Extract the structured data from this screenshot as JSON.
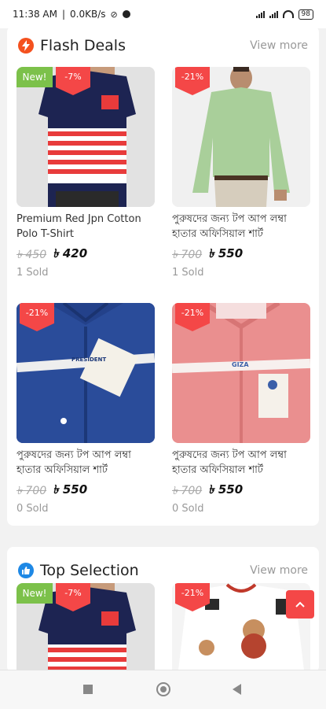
{
  "status_bar": {
    "time": "11:38 AM",
    "network_speed": "0.0KB/s",
    "battery": "98",
    "icons": [
      "sync-off-icon",
      "messenger-icon",
      "signal-icon",
      "signal-icon",
      "wifi-icon",
      "battery-icon"
    ]
  },
  "flash_deals": {
    "title": "Flash Deals",
    "view_more": "View more",
    "icon": "lightning-icon",
    "accent": "#f4511e",
    "products": [
      {
        "new_tag": "New!",
        "discount": "-7%",
        "title": "Premium Red Jpn Cotton Polo T-Shirt",
        "old_price": "৳ 450",
        "price": "৳ 420",
        "sold": "1 Sold",
        "image": "red-white-blue-polo-shirt"
      },
      {
        "new_tag": "",
        "discount": "-21%",
        "title": "পুরুষদের জন্য টপ আপ লম্বা হাতার অফিসিয়াল শার্ট",
        "old_price": "৳ 700",
        "price": "৳ 550",
        "sold": "1 Sold",
        "image": "green-formal-shirt"
      },
      {
        "new_tag": "",
        "discount": "-21%",
        "title": "পুরুষদের জন্য টপ আপ লম্বা হাতার অফিসিয়াল শার্ট",
        "old_price": "৳ 700",
        "price": "৳ 550",
        "sold": "0 Sold",
        "image": "navy-folded-shirt",
        "brand": "PRESIDENT"
      },
      {
        "new_tag": "",
        "discount": "-21%",
        "title": "পুরুষদের জন্য টপ আপ লম্বা হাতার অফিসিয়াল শার্ট",
        "old_price": "৳ 700",
        "price": "৳ 550",
        "sold": "0 Sold",
        "image": "pink-folded-shirt",
        "brand": "GIZA"
      }
    ]
  },
  "top_selection": {
    "title": "Top Selection",
    "view_more": "View more",
    "icon": "thumbs-up-icon",
    "accent": "#1e88e5",
    "products": [
      {
        "new_tag": "New!",
        "discount": "-7%",
        "image": "red-white-blue-polo-shirt"
      },
      {
        "new_tag": "",
        "discount": "-21%",
        "image": "white-tshirt-bear-print"
      }
    ]
  },
  "scroll_top_icon": "chevron-up-icon",
  "nav_bar": {
    "icons": [
      "recent-apps-icon",
      "home-icon",
      "back-icon"
    ]
  },
  "colors": {
    "discount": "#f44747",
    "new_tag": "#7cc14a"
  }
}
